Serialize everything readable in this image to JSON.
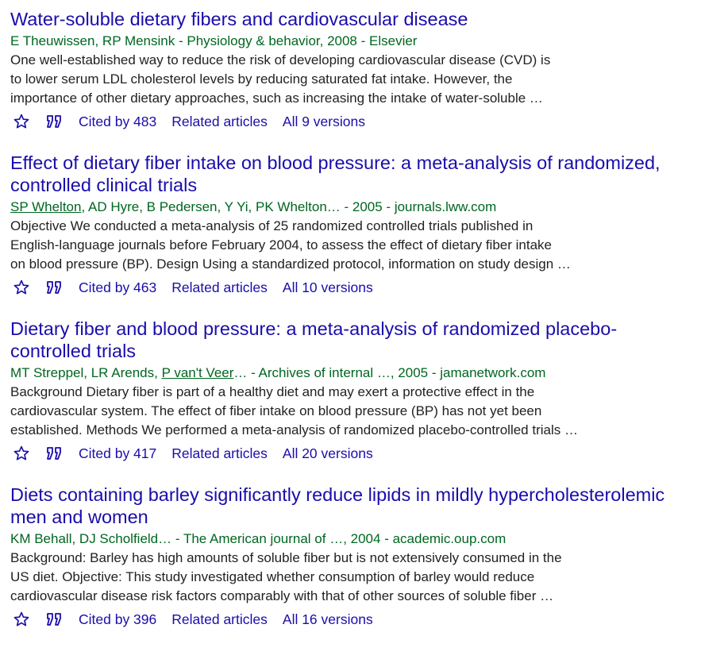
{
  "colors": {
    "title_link": "#1a0dab",
    "meta_green": "#006621",
    "snippet_text": "#222222",
    "action_link": "#1a0dab"
  },
  "icons": {
    "save": "star-icon",
    "cite": "quote-icon"
  },
  "results": [
    {
      "title_lines": [
        "Water-soluble dietary fibers and cardiovascular disease"
      ],
      "meta": {
        "authors_linked": "",
        "authors_plain": "E Theuwissen, RP Mensink",
        "source": " - Physiology & behavior, 2008 - Elsevier"
      },
      "snippet_lines": [
        "One well-established way to reduce the risk of developing cardiovascular disease (CVD) is",
        "to lower serum LDL cholesterol levels by reducing saturated fat intake. However, the",
        "importance of other dietary approaches, such as increasing the intake of water-soluble …"
      ],
      "cited_by": "Cited by 483",
      "related": "Related articles",
      "versions": "All 9 versions"
    },
    {
      "title_lines": [
        "Effect of dietary fiber intake on blood pressure: a meta-analysis of randomized,",
        "controlled clinical trials"
      ],
      "meta": {
        "authors_linked": "SP Whelton",
        "authors_plain": ", AD Hyre, B Pedersen, Y Yi, PK Whelton…",
        "source": " - 2005 - journals.lww.com"
      },
      "snippet_lines": [
        "Objective We conducted a meta-analysis of 25 randomized controlled trials published in",
        "English-language journals before February 2004, to assess the effect of dietary fiber intake",
        "on blood pressure (BP). Design Using a standardized protocol, information on study design …"
      ],
      "cited_by": "Cited by 463",
      "related": "Related articles",
      "versions": "All 10 versions"
    },
    {
      "title_lines": [
        "Dietary fiber and blood pressure: a meta-analysis of randomized placebo-",
        "controlled trials"
      ],
      "meta": {
        "authors_prefix": "MT Streppel, LR Arends, ",
        "authors_linked": "P van't Veer",
        "authors_plain": "…",
        "source": " - Archives of internal …, 2005 - jamanetwork.com"
      },
      "snippet_lines": [
        "Background Dietary fiber is part of a healthy diet and may exert a protective effect in the",
        "cardiovascular system. The effect of fiber intake on blood pressure (BP) has not yet been",
        "established. Methods We performed a meta-analysis of randomized placebo-controlled trials …"
      ],
      "cited_by": "Cited by 417",
      "related": "Related articles",
      "versions": "All 20 versions"
    },
    {
      "title_lines": [
        "Diets containing barley significantly reduce lipids in mildly hypercholesterolemic",
        "men and women"
      ],
      "meta": {
        "authors_linked": "",
        "authors_plain": "KM Behall, DJ Scholfield…",
        "source": " - The American journal of …, 2004 - academic.oup.com"
      },
      "snippet_lines": [
        "Background: Barley has high amounts of soluble fiber but is not extensively consumed in the",
        "US diet. Objective: This study investigated whether consumption of barley would reduce",
        "cardiovascular disease risk factors comparably with that of other sources of soluble fiber …"
      ],
      "cited_by": "Cited by 396",
      "related": "Related articles",
      "versions": "All 16 versions"
    }
  ]
}
